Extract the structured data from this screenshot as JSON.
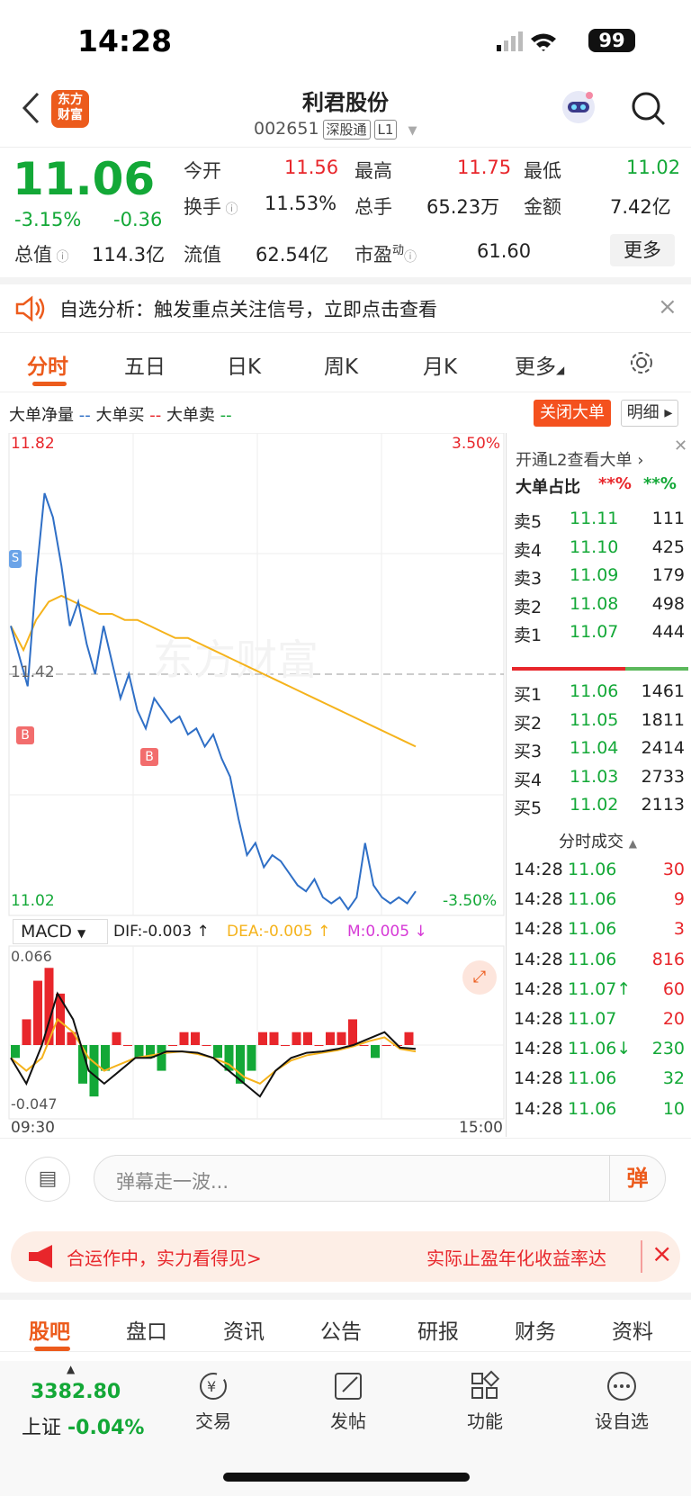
{
  "status": {
    "time": "14:28",
    "battery": "99"
  },
  "header": {
    "stock_name": "利君股份",
    "code": "002651",
    "tag1": "深股通",
    "tag2": "L1",
    "logo_line1": "东方",
    "logo_line2": "财富"
  },
  "quote": {
    "price": "11.06",
    "pct": "-3.15%",
    "chg": "-0.36",
    "open_l": "今开",
    "open": "11.56",
    "high_l": "最高",
    "high": "11.75",
    "low_l": "最低",
    "low": "11.02",
    "turn_l": "换手",
    "turn": "11.53%",
    "vol_l": "总手",
    "vol": "65.23万",
    "amt_l": "金额",
    "amt": "7.42亿",
    "mcap_l": "总值",
    "mcap": "114.3亿",
    "float_l": "流值",
    "float": "62.54亿",
    "pe_l": "市盈",
    "pe_sup": "动",
    "pe": "61.60",
    "more": "更多"
  },
  "alert": {
    "text": "自选分析：触发重点关注信号，立即点击查看"
  },
  "tabs": [
    "分时",
    "五日",
    "日K",
    "周K",
    "月K",
    "更多"
  ],
  "chart_header": {
    "net": "大单净量",
    "net_dash": "--",
    "buy": "大单买",
    "buy_dash": "--",
    "sell": "大单卖",
    "sell_dash": "--",
    "close_btn": "关闭大单",
    "detail_btn": "明细"
  },
  "chart_labels": {
    "top_price": "11.82",
    "bottom_price": "11.02",
    "mid_price": "11.42",
    "top_pct": "3.50%",
    "bottom_pct": "-3.50%",
    "start_time": "09:30",
    "end_time": "15:00",
    "watermark": "东方财富",
    "b_marker": "B",
    "s_marker": "S"
  },
  "macd": {
    "name": "MACD",
    "dif": "DIF:-0.003 ↑",
    "dea": "DEA:-0.005 ↑",
    "m": "M:0.005 ↓",
    "top": "0.066",
    "bottom": "-0.047"
  },
  "chart_data": {
    "type": "line",
    "x_start": "09:30",
    "x_end": "15:00",
    "ylim": [
      11.02,
      11.82
    ],
    "price": [
      11.5,
      11.45,
      11.4,
      11.58,
      11.72,
      11.68,
      11.6,
      11.5,
      11.54,
      11.47,
      11.42,
      11.5,
      11.44,
      11.38,
      11.42,
      11.36,
      11.33,
      11.38,
      11.36,
      11.34,
      11.35,
      11.32,
      11.33,
      11.3,
      11.32,
      11.28,
      11.25,
      11.18,
      11.12,
      11.14,
      11.1,
      11.12,
      11.11,
      11.09,
      11.07,
      11.06,
      11.08,
      11.05,
      11.04,
      11.05,
      11.03,
      11.05,
      11.14,
      11.07,
      11.05,
      11.04,
      11.05,
      11.04,
      11.06
    ],
    "avg": [
      11.5,
      11.46,
      11.51,
      11.54,
      11.55,
      11.54,
      11.53,
      11.52,
      11.52,
      11.51,
      11.51,
      11.5,
      11.49,
      11.48,
      11.48,
      11.47,
      11.46,
      11.45,
      11.44,
      11.43,
      11.42,
      11.41,
      11.4,
      11.39,
      11.38,
      11.37,
      11.36,
      11.35,
      11.34,
      11.33,
      11.32,
      11.31,
      11.3
    ],
    "macd_hist": [
      -0.01,
      0.02,
      0.05,
      0.06,
      0.04,
      0.01,
      -0.03,
      -0.04,
      -0.02,
      0.01,
      0.0,
      -0.01,
      -0.01,
      -0.02,
      0.0,
      0.01,
      0.01,
      0.0,
      -0.01,
      -0.02,
      -0.03,
      -0.02,
      0.01,
      0.01,
      0.0,
      0.01,
      0.01,
      0.0,
      0.01,
      0.01,
      0.02,
      0.0,
      -0.01,
      0.0,
      0.0,
      0.01
    ],
    "dif": [
      -0.01,
      -0.03,
      0.0,
      0.04,
      0.02,
      -0.02,
      -0.03,
      -0.02,
      -0.01,
      -0.01,
      -0.005,
      -0.005,
      -0.006,
      -0.01,
      -0.02,
      -0.03,
      -0.04,
      -0.02,
      -0.01,
      -0.006,
      -0.005,
      -0.003,
      0.0,
      0.005,
      0.01,
      -0.002,
      -0.003
    ],
    "dea": [
      -0.01,
      -0.02,
      -0.01,
      0.02,
      0.01,
      -0.01,
      -0.02,
      -0.015,
      -0.01,
      -0.008,
      -0.006,
      -0.005,
      -0.007,
      -0.01,
      -0.015,
      -0.025,
      -0.03,
      -0.02,
      -0.012,
      -0.008,
      -0.006,
      -0.004,
      -0.001,
      0.003,
      0.006,
      -0.003,
      -0.005
    ]
  },
  "orderbook": {
    "link": "开通L2查看大单",
    "ratio_l": "大单占比",
    "ratio_buy": "**%",
    "ratio_sell": "**%",
    "asks": [
      {
        "l": "卖5",
        "p": "11.11",
        "v": "111"
      },
      {
        "l": "卖4",
        "p": "11.10",
        "v": "425"
      },
      {
        "l": "卖3",
        "p": "11.09",
        "v": "179"
      },
      {
        "l": "卖2",
        "p": "11.08",
        "v": "498"
      },
      {
        "l": "卖1",
        "p": "11.07",
        "v": "444"
      }
    ],
    "bids": [
      {
        "l": "买1",
        "p": "11.06",
        "v": "1461"
      },
      {
        "l": "买2",
        "p": "11.05",
        "v": "1811"
      },
      {
        "l": "买3",
        "p": "11.04",
        "v": "2414"
      },
      {
        "l": "买4",
        "p": "11.03",
        "v": "2733"
      },
      {
        "l": "买5",
        "p": "11.02",
        "v": "2113"
      }
    ],
    "trades_title": "分时成交",
    "trades": [
      {
        "t": "14:28",
        "p": "11.06",
        "v": "30",
        "c": "red"
      },
      {
        "t": "14:28",
        "p": "11.06",
        "v": "9",
        "c": "red"
      },
      {
        "t": "14:28",
        "p": "11.06",
        "v": "3",
        "c": "red"
      },
      {
        "t": "14:28",
        "p": "11.06",
        "v": "816",
        "c": "red"
      },
      {
        "t": "14:28",
        "p": "11.07↑",
        "v": "60",
        "c": "red"
      },
      {
        "t": "14:28",
        "p": "11.07",
        "v": "20",
        "c": "red"
      },
      {
        "t": "14:28",
        "p": "11.06↓",
        "v": "230",
        "c": "green"
      },
      {
        "t": "14:28",
        "p": "11.06",
        "v": "32",
        "c": "green"
      },
      {
        "t": "14:28",
        "p": "11.06",
        "v": "10",
        "c": "green"
      }
    ]
  },
  "bullet": {
    "placeholder": "弹幕走一波...",
    "btn": "弹"
  },
  "ad": {
    "left": "合运作中，实力看得见>",
    "right": "实际止盈年化收益率达"
  },
  "bottom_tabs": [
    "股吧",
    "盘口",
    "资讯",
    "公告",
    "研报",
    "财务",
    "资料"
  ],
  "footer": {
    "index_value": "3382.80",
    "index_name": "上证",
    "index_pct": "-0.04%",
    "items": [
      "交易",
      "发帖",
      "功能",
      "设自选"
    ]
  },
  "colors": {
    "up": "#e8262b",
    "down": "#13a837",
    "accent": "#ec5b1c",
    "price_line": "#2f6fc6",
    "avg_line": "#f5b31c"
  }
}
